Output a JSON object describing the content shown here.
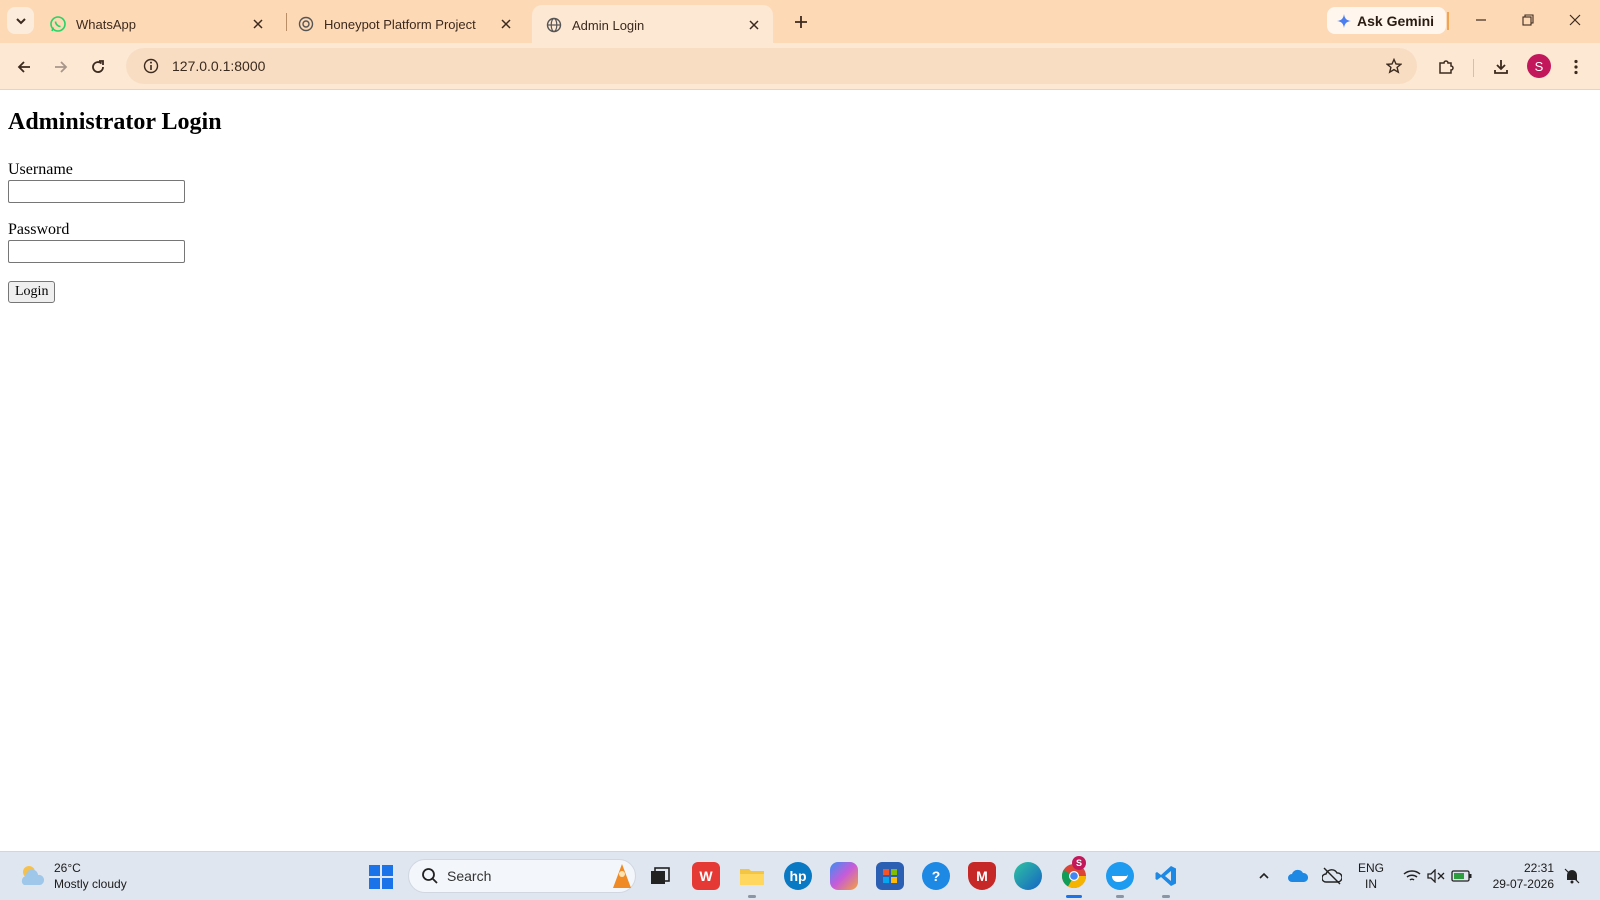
{
  "browser": {
    "tabs": [
      {
        "label": "WhatsApp",
        "icon": "whatsapp-icon",
        "active": false
      },
      {
        "label": "Honeypot Platform Project",
        "icon": "openai-icon",
        "active": false
      },
      {
        "label": "Admin Login",
        "icon": "globe-icon",
        "active": true
      }
    ],
    "gemini_label": "Ask Gemini",
    "url": "127.0.0.1:8000",
    "profile_initial": "S",
    "profile_color": "#c2185b",
    "accent_color": "#fdd9b6"
  },
  "page": {
    "heading": "Administrator Login",
    "username_label": "Username",
    "username_value": "",
    "password_label": "Password",
    "password_value": "",
    "login_button": "Login"
  },
  "taskbar": {
    "weather_temp": "26°C",
    "weather_desc": "Mostly cloudy",
    "search_placeholder": "Search",
    "apps": [
      "task-view-icon",
      "wps-office-icon",
      "file-explorer-icon",
      "hp-icon",
      "copilot-icon",
      "microsoft-store-icon",
      "help-icon",
      "mcafee-icon",
      "edge-icon",
      "chrome-icon",
      "docker-icon",
      "vscode-icon"
    ],
    "chrome_badge": "S",
    "lang_line1": "ENG",
    "lang_line2": "IN",
    "time": "22:31",
    "date": "29-07-2026"
  }
}
